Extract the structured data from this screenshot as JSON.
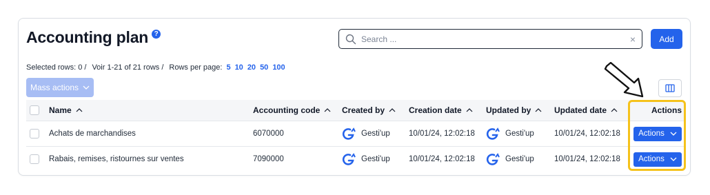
{
  "header": {
    "title": "Accounting plan",
    "help_icon": "question-icon",
    "help_glyph": "?"
  },
  "search": {
    "placeholder": "Search ...",
    "value": "",
    "clear_glyph": "×"
  },
  "add_button": {
    "label": "Add"
  },
  "table_meta": {
    "selected": "Selected rows: 0 /",
    "range": "Voir 1-21 of 21 rows /",
    "rows_per_page_label": "Rows per page:",
    "page_sizes": [
      "5",
      "10",
      "20",
      "50",
      "100"
    ]
  },
  "mass_actions": {
    "label": "Mass actions"
  },
  "columns": {
    "name": "Name",
    "code": "Accounting code",
    "created_by": "Created by",
    "creation_date": "Creation date",
    "updated_by": "Updated by",
    "updated_date": "Updated date",
    "actions": "Actions"
  },
  "rows": [
    {
      "name": "Achats de marchandises",
      "code": "6070000",
      "created_by": "Gesti'up",
      "creation_date": "10/01/24, 12:02:18",
      "updated_by": "Gesti'up",
      "updated_date": "10/01/24, 12:02:18",
      "action_label": "Actions"
    },
    {
      "name": "Rabais, remises, ristournes sur ventes",
      "code": "7090000",
      "created_by": "Gesti'up",
      "creation_date": "10/01/24, 12:02:18",
      "updated_by": "Gesti'up",
      "updated_date": "10/01/24, 12:02:18",
      "action_label": "Actions"
    }
  ],
  "colors": {
    "primary": "#2463eb",
    "mass_disabled": "#a7bdf4",
    "highlight": "#f5c21b",
    "header_bg": "#f5f6f8"
  }
}
